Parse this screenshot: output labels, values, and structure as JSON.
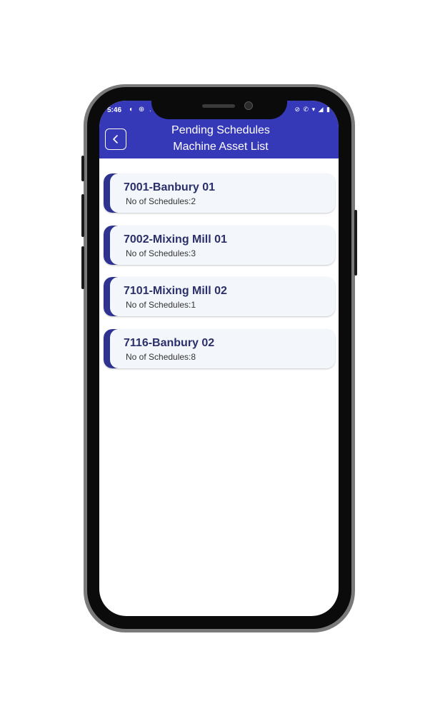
{
  "status_bar": {
    "time": "5:46",
    "left_icons": "◐ ⊕ .",
    "right_icons": "⊘ ✆ ▾ ◢ ▮"
  },
  "header": {
    "title_line1": "Pending Schedules",
    "title_line2": "Machine Asset List",
    "back_icon": "chevron-left-icon"
  },
  "machines": [
    {
      "name": "7001-Banbury 01",
      "schedules": "No of Schedules:2"
    },
    {
      "name": "7002-Mixing Mill 01",
      "schedules": "No of Schedules:3"
    },
    {
      "name": "7101-Mixing Mill 02",
      "schedules": "No of Schedules:1"
    },
    {
      "name": "7116-Banbury 02",
      "schedules": "No of Schedules:8"
    }
  ],
  "colors": {
    "header": "#3539b8",
    "accent": "#2f3390",
    "card_bg": "#f3f7fb",
    "title_text": "#2b2f6b"
  }
}
